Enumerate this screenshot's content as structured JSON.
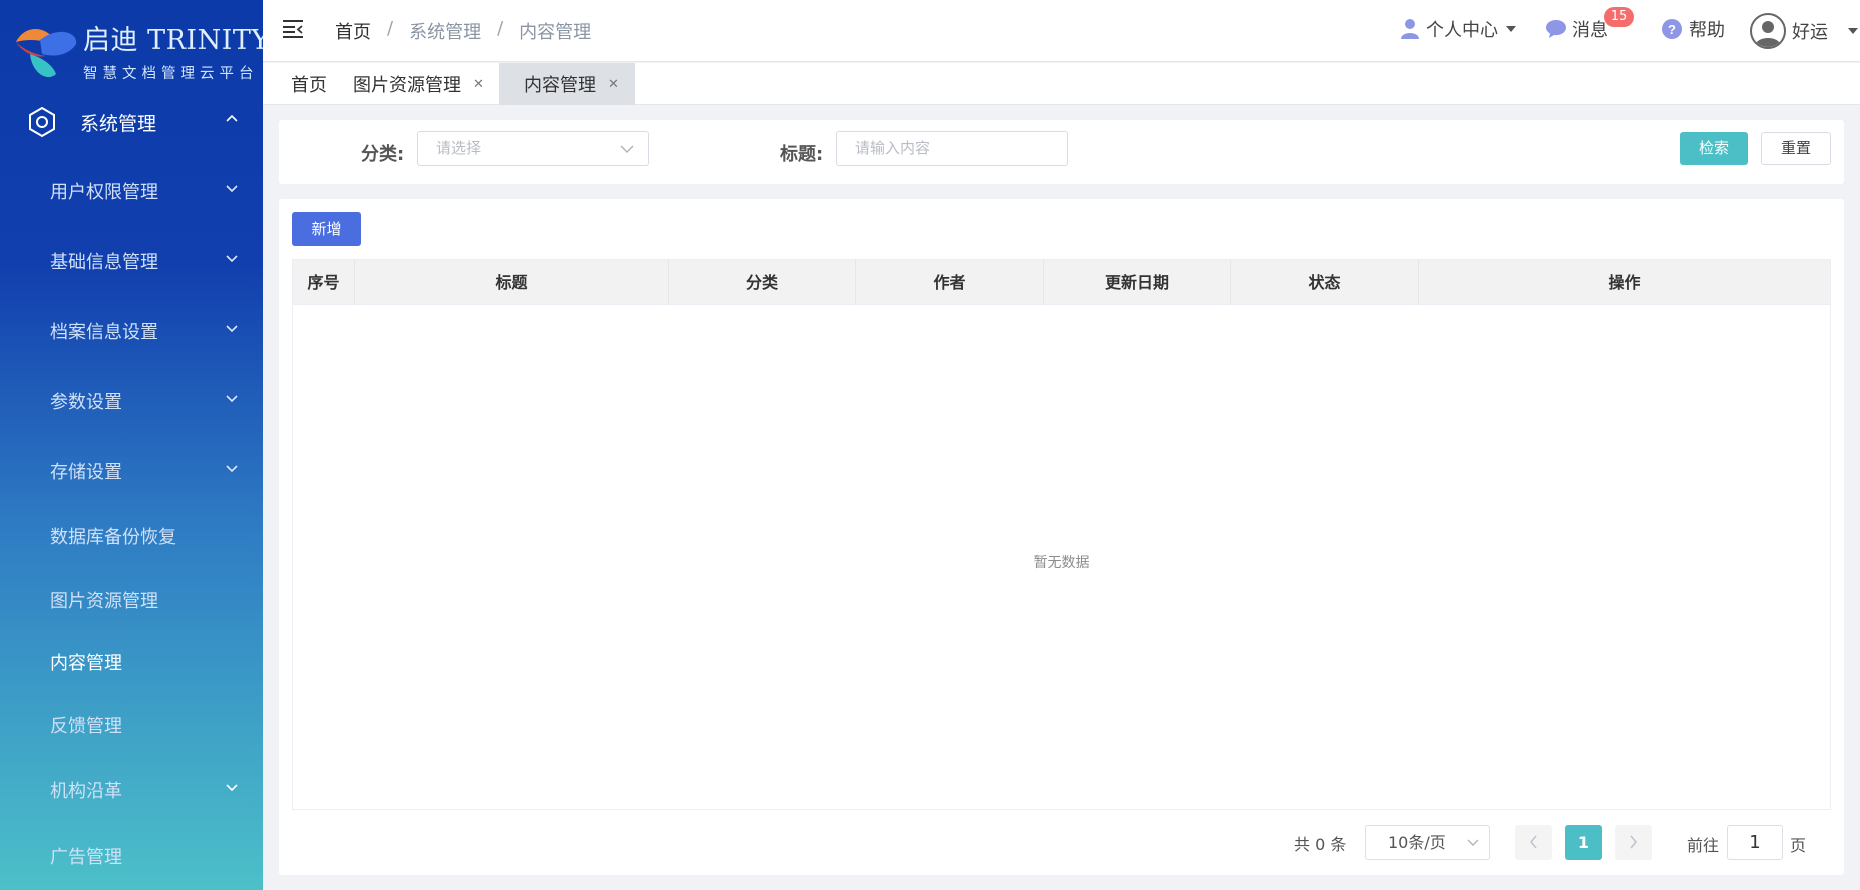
{
  "brand": {
    "title": "启迪 TRINITY",
    "subtitle": "智慧文档管理云平台"
  },
  "sidebar": {
    "section": {
      "label": "系统管理",
      "icon": "settings-hexagon-icon"
    },
    "items": [
      {
        "label": "用户权限管理",
        "has_children": true
      },
      {
        "label": "基础信息管理",
        "has_children": true
      },
      {
        "label": "档案信息设置",
        "has_children": true
      },
      {
        "label": "参数设置",
        "has_children": true
      },
      {
        "label": "存储设置",
        "has_children": true
      },
      {
        "label": "数据库备份恢复",
        "has_children": false
      },
      {
        "label": "图片资源管理",
        "has_children": false
      },
      {
        "label": "内容管理",
        "has_children": false,
        "active": true
      },
      {
        "label": "反馈管理",
        "has_children": false
      },
      {
        "label": "机构沿革",
        "has_children": true
      },
      {
        "label": "广告管理",
        "has_children": false
      }
    ]
  },
  "header": {
    "breadcrumb": [
      "首页",
      "系统管理",
      "内容管理"
    ],
    "user_center": "个人中心",
    "messages": "消息",
    "message_count": "15",
    "help": "帮助",
    "username": "好运"
  },
  "tabs": [
    {
      "label": "首页",
      "closable": false
    },
    {
      "label": "图片资源管理",
      "closable": true
    },
    {
      "label": "内容管理",
      "closable": true,
      "active": true
    }
  ],
  "filters": {
    "category_label": "分类:",
    "category_placeholder": "请选择",
    "title_label": "标题:",
    "title_placeholder": "请输入内容",
    "search_button": "检索",
    "reset_button": "重置"
  },
  "table": {
    "add_button": "新增",
    "columns": [
      "序号",
      "标题",
      "分类",
      "作者",
      "更新日期",
      "状态",
      "操作"
    ],
    "rows": [],
    "empty_text": "暂无数据"
  },
  "pagination": {
    "total_text": "共 0 条",
    "page_size": "10条/页",
    "current_page": "1",
    "goto_label": "前往",
    "goto_value": "1",
    "page_suffix": "页"
  },
  "colors": {
    "accent": "#4cbfc6",
    "primary": "#4a6ee0",
    "badge": "#f56c6c"
  }
}
